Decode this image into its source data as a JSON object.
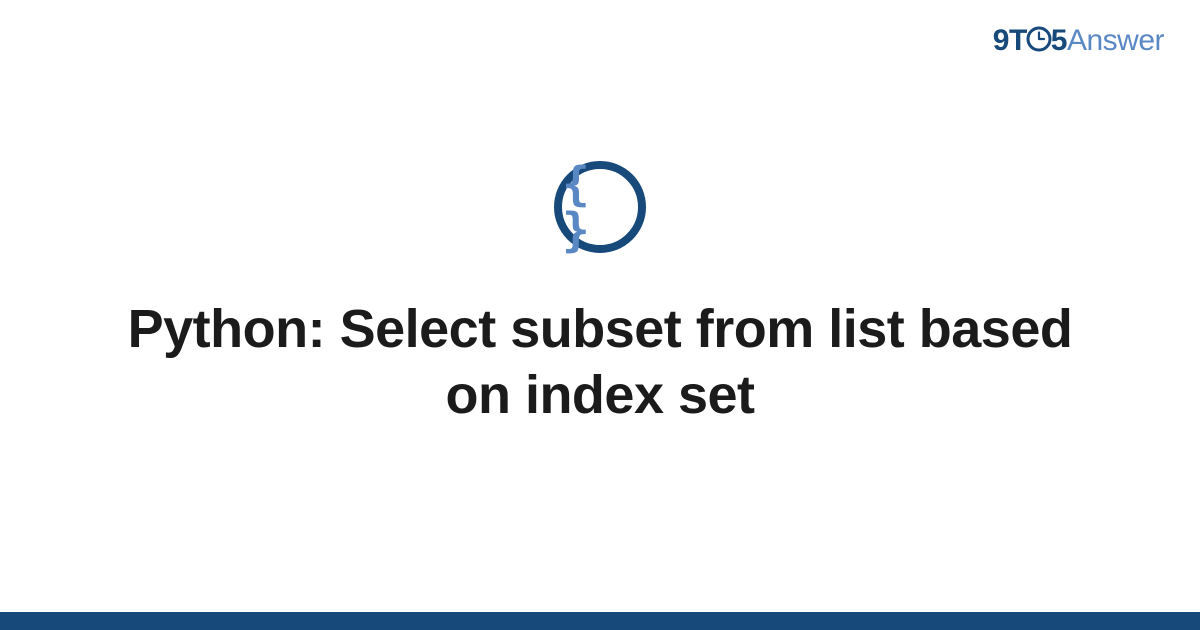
{
  "header": {
    "logo_nine": "9",
    "logo_t": "T",
    "logo_five": "5",
    "logo_answer": "Answer"
  },
  "badge": {
    "glyph": "{ }",
    "icon_name": "code-braces"
  },
  "main": {
    "title": "Python: Select subset from list based on index set"
  },
  "colors": {
    "brand_dark": "#17497a",
    "brand_light": "#5a88c4"
  }
}
